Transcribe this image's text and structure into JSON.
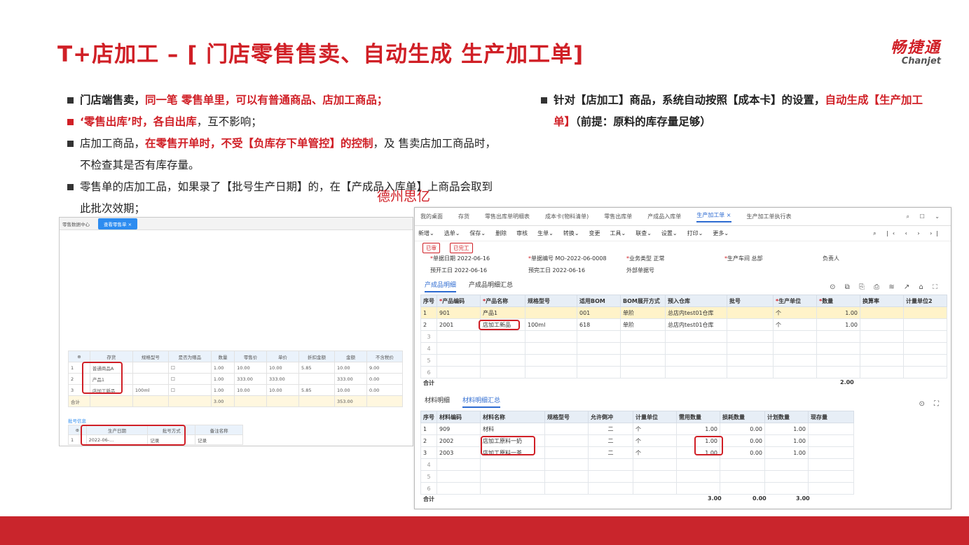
{
  "slide": {
    "title": "T+店加工 – [ 门店零售售卖、自动生成 生产加工单]",
    "logo_cn": "畅捷通",
    "logo_en": "Chanjet",
    "watermark": "德州思亿"
  },
  "bullets_left": [
    {
      "plain": "门店端售卖，",
      "red": "同一笔 零售单里，可以有普通商品、店加工商品；"
    },
    {
      "red": "‘零售出库’时，各自出库",
      "plain": "，互不影响；"
    },
    {
      "plain": "店加工商品，",
      "red": "在零售开单时，不受【负库存下单管控】的控制",
      "plain2": "，及 售卖店加工商品时，不检查其是否有库存量。"
    },
    {
      "plain": "零售单的店加工品，如果录了【批号生产日期】的，在【产成品入库单】上商品会取到此批次效期；"
    }
  ],
  "bullets_right": [
    {
      "bold": "针对【店加工】商品，系统自动按照【成本卡】的设置，",
      "red": "自动生成【生产加工单】",
      "bold2": "（前提：原料的库存量足够）"
    }
  ],
  "left_shot": {
    "tab_home": "零售数据中心",
    "tab_active": "查看零售单",
    "grid_headers": [
      "存货",
      "规格型号",
      "是否为赠品",
      "数量",
      "零售价",
      "单价",
      "折扣金额",
      "金额",
      "不含税价"
    ],
    "grid_rows": [
      {
        "no": "1",
        "name": "普通商品A",
        "spec": "",
        "qty": "1.00",
        "price": "10.00",
        "unit": "10.00",
        "disc": "5.85",
        "amt": "10.00",
        "net": "9.00"
      },
      {
        "no": "2",
        "name": "产品1",
        "spec": "",
        "qty": "1.00",
        "price": "333.00",
        "unit": "333.00",
        "disc": "",
        "amt": "333.00",
        "net": "0.00"
      },
      {
        "no": "3",
        "name": "店加工新品",
        "spec": "100ml",
        "qty": "1.00",
        "price": "10.00",
        "unit": "10.00",
        "disc": "5.85",
        "amt": "10.00",
        "net": "0.00"
      }
    ],
    "grid_total_label": "合计",
    "grid_total_qty": "3.00",
    "grid_total_amt": "353.00",
    "batch_tab": "批号信息",
    "batch_headers": [
      "生产日期",
      "批号方式",
      "备注名称"
    ],
    "batch_row": [
      "2022-06-...",
      "记录",
      "记录"
    ]
  },
  "right_shot": {
    "tabs": [
      "我的桌面",
      "存货",
      "零售出库单明细表",
      "成本卡(物料清单)",
      "零售出库单",
      "产成品入库单",
      "生产加工单",
      "生产加工单执行表"
    ],
    "active_tab": "生产加工单",
    "toolbar": [
      "新增",
      "选单",
      "保存",
      "删除",
      "审核",
      "生单",
      "转换",
      "变更",
      "工具",
      "联查",
      "设置",
      "打印",
      "更多"
    ],
    "btn_submit": "已审",
    "btn_status": "已完工",
    "form": {
      "doc_date_label": "单据日期",
      "doc_date": "2022-06-16",
      "doc_no_label": "单据编号",
      "doc_no": "MO-2022-06-0008",
      "biz_type_label": "业务类型",
      "biz_type": "正常",
      "dept_label": "生产车间",
      "dept": "总部",
      "person_label": "负责人",
      "start_label": "预开工日",
      "start_date": "2022-06-16",
      "finish_label": "预完工日",
      "finish_date": "2022-06-16",
      "ext_label": "外部单据号"
    },
    "sub_tabs": [
      "产成品明细",
      "产成品明细汇总"
    ],
    "product_headers": [
      "序号",
      "产品编码",
      "产品名称",
      "规格型号",
      "适用BOM",
      "BOM展开方式",
      "预入仓库",
      "批号",
      "生产单位",
      "数量",
      "换算率",
      "计量单位2"
    ],
    "product_rows": [
      {
        "no": "1",
        "code": "901",
        "name": "产品1",
        "spec": "",
        "bom": "001",
        "expand": "单阶",
        "wh": "总店内test01仓库",
        "batch": "",
        "unit": "个",
        "qty": "1.00"
      },
      {
        "no": "2",
        "code": "2001",
        "name": "店加工新品",
        "spec": "100ml",
        "bom": "618",
        "expand": "单阶",
        "wh": "总店内test01仓库",
        "batch": "",
        "unit": "个",
        "qty": "1.00"
      }
    ],
    "product_total_label": "合计",
    "product_total": "2.00",
    "mat_tabs": [
      "材料明细",
      "材料明细汇总"
    ],
    "material_headers": [
      "序号",
      "材料编码",
      "材料名称",
      "规格型号",
      "允许倒冲",
      "计量单位",
      "需用数量",
      "损耗数量",
      "计划数量",
      "现存量"
    ],
    "material_rows": [
      {
        "no": "1",
        "code": "909",
        "name": "材料",
        "flag": "二",
        "unit": "个",
        "need": "1.00",
        "loss": "0.00",
        "plan": "1.00"
      },
      {
        "no": "2",
        "code": "2002",
        "name": "店加工原料一奶",
        "flag": "二",
        "unit": "个",
        "need": "1.00",
        "loss": "0.00",
        "plan": "1.00"
      },
      {
        "no": "3",
        "code": "2003",
        "name": "店加工原料一茶",
        "flag": "二",
        "unit": "个",
        "need": "1.00",
        "loss": "0.00",
        "plan": "1.00"
      }
    ],
    "material_total_label": "合计",
    "material_total_need": "3.00",
    "material_total_loss": "0.00",
    "material_total_plan": "3.00",
    "empty_rows": [
      "3",
      "4",
      "5",
      "6"
    ],
    "empty_rows_mat": [
      "4",
      "5",
      "6"
    ]
  },
  "colors": {
    "accent": "#d01f26",
    "link": "#2d6bd1"
  }
}
